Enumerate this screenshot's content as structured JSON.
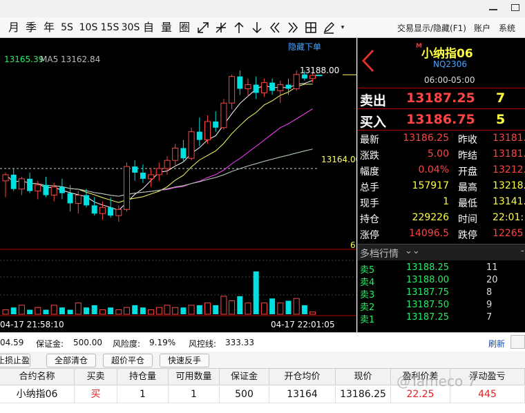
{
  "toolbar": {
    "periods": [
      "月",
      "季",
      "年",
      "5S",
      "10S",
      "15S",
      "30S",
      "自",
      "量",
      "圈"
    ],
    "menu": [
      "交易显示/隐藏(F1)",
      "账户",
      "系统"
    ]
  },
  "chart": {
    "price_label": "13165.39",
    "ma_label": "MA5 13162.84",
    "hide_orders": "隐藏下单",
    "high_label": "13188.00",
    "level_label": "13164.00",
    "right_mark": "6",
    "time_left": "04-17 21:58:10",
    "time_right": "04-17 22:01:05"
  },
  "chart_data": {
    "type": "candlestick",
    "x_start_label": "04-17 21:58:10",
    "x_end_label": "04-17 22:01:05",
    "price_labels": [
      "13188.00",
      "13164.00"
    ],
    "candles": [
      {
        "o": 13161.0,
        "h": 13163.0,
        "l": 13157.0,
        "c": 13162.5
      },
      {
        "o": 13162.5,
        "h": 13164.0,
        "l": 13158.5,
        "c": 13159.0
      },
      {
        "o": 13159.0,
        "h": 13162.0,
        "l": 13157.5,
        "c": 13161.5
      },
      {
        "o": 13161.5,
        "h": 13163.0,
        "l": 13158.0,
        "c": 13158.5
      },
      {
        "o": 13158.5,
        "h": 13161.0,
        "l": 13156.5,
        "c": 13160.0
      },
      {
        "o": 13160.0,
        "h": 13162.0,
        "l": 13157.0,
        "c": 13157.5
      },
      {
        "o": 13157.5,
        "h": 13160.5,
        "l": 13156.0,
        "c": 13159.5
      },
      {
        "o": 13159.5,
        "h": 13161.5,
        "l": 13156.5,
        "c": 13158.0
      },
      {
        "o": 13158.0,
        "h": 13160.0,
        "l": 13153.5,
        "c": 13155.5
      },
      {
        "o": 13155.5,
        "h": 13158.5,
        "l": 13153.0,
        "c": 13157.5
      },
      {
        "o": 13157.5,
        "h": 13159.0,
        "l": 13154.5,
        "c": 13155.0
      },
      {
        "o": 13155.0,
        "h": 13157.0,
        "l": 13152.5,
        "c": 13153.0
      },
      {
        "o": 13153.0,
        "h": 13156.0,
        "l": 13151.5,
        "c": 13154.5
      },
      {
        "o": 13154.5,
        "h": 13157.0,
        "l": 13152.0,
        "c": 13152.5
      },
      {
        "o": 13152.5,
        "h": 13155.0,
        "l": 13151.0,
        "c": 13154.0
      },
      {
        "o": 13154.0,
        "h": 13165.5,
        "l": 13153.5,
        "c": 13164.5
      },
      {
        "o": 13164.5,
        "h": 13166.0,
        "l": 13161.0,
        "c": 13163.0
      },
      {
        "o": 13163.0,
        "h": 13165.0,
        "l": 13160.5,
        "c": 13161.5
      },
      {
        "o": 13161.5,
        "h": 13164.0,
        "l": 13159.5,
        "c": 13162.5
      },
      {
        "o": 13162.5,
        "h": 13165.5,
        "l": 13161.0,
        "c": 13164.0
      },
      {
        "o": 13164.0,
        "h": 13167.0,
        "l": 13162.5,
        "c": 13166.0
      },
      {
        "o": 13166.0,
        "h": 13170.0,
        "l": 13164.5,
        "c": 13169.0
      },
      {
        "o": 13169.0,
        "h": 13171.0,
        "l": 13165.5,
        "c": 13166.5
      },
      {
        "o": 13166.5,
        "h": 13174.0,
        "l": 13166.0,
        "c": 13173.0
      },
      {
        "o": 13173.0,
        "h": 13176.5,
        "l": 13169.5,
        "c": 13171.0
      },
      {
        "o": 13171.0,
        "h": 13177.0,
        "l": 13170.0,
        "c": 13175.5
      },
      {
        "o": 13175.5,
        "h": 13178.0,
        "l": 13173.0,
        "c": 13174.0
      },
      {
        "o": 13174.0,
        "h": 13181.0,
        "l": 13173.5,
        "c": 13180.0
      },
      {
        "o": 13180.0,
        "h": 13187.0,
        "l": 13178.5,
        "c": 13186.5
      },
      {
        "o": 13186.5,
        "h": 13188.0,
        "l": 13182.0,
        "c": 13183.5
      },
      {
        "o": 13183.5,
        "h": 13186.0,
        "l": 13181.5,
        "c": 13184.5
      },
      {
        "o": 13184.5,
        "h": 13186.5,
        "l": 13181.0,
        "c": 13182.5
      },
      {
        "o": 13182.5,
        "h": 13186.0,
        "l": 13181.5,
        "c": 13185.0
      },
      {
        "o": 13185.0,
        "h": 13186.0,
        "l": 13182.0,
        "c": 13183.0
      },
      {
        "o": 13183.0,
        "h": 13185.5,
        "l": 13180.0,
        "c": 13184.5
      },
      {
        "o": 13184.5,
        "h": 13186.0,
        "l": 13182.0,
        "c": 13183.5
      },
      {
        "o": 13183.5,
        "h": 13188.0,
        "l": 13183.0,
        "c": 13187.0
      },
      {
        "o": 13187.0,
        "h": 13188.0,
        "l": 13185.5,
        "c": 13186.0
      },
      {
        "o": 13186.0,
        "h": 13187.5,
        "l": 13185.0,
        "c": 13186.75
      }
    ],
    "volumes": [
      2,
      3,
      4,
      2,
      3,
      2,
      4,
      3,
      2,
      5,
      3,
      4,
      2,
      3,
      2,
      3,
      4,
      3,
      2,
      3,
      4,
      3,
      3,
      4,
      4,
      5,
      4,
      8,
      6,
      8,
      5,
      19,
      5,
      7,
      5,
      6,
      7,
      4,
      1
    ],
    "ma_colors": [
      "#ffffff",
      "#ffff66",
      "#ff44ff",
      "#44dd44",
      "#bbbbbb"
    ]
  },
  "quote": {
    "name": "小纳指06",
    "code": "NQ2306",
    "hours": "06:00-05:00",
    "sell": {
      "label": "卖出",
      "price": "13187.25",
      "vol": "7"
    },
    "buy": {
      "label": "买入",
      "price": "13186.75",
      "vol": "5"
    },
    "stats": [
      [
        "最新",
        "13186.25",
        "昨收",
        "13181.",
        "#ff4444"
      ],
      [
        "涨跌",
        "5.00",
        "昨结",
        "13181.",
        "#ff4444"
      ],
      [
        "幅度",
        "0.04%",
        "开盘",
        "13212.",
        "#ff4444"
      ],
      [
        "总手",
        "157917",
        "最高",
        "13218.",
        "#ffff44"
      ],
      [
        "现手",
        "1",
        "最低",
        "13141.",
        "#ffff44"
      ],
      [
        "持仓",
        "229226",
        "时间",
        "22:01:",
        "#ffff44"
      ],
      [
        "涨停",
        "14096.5",
        "跌停",
        "12265",
        "#ff4444"
      ]
    ],
    "depth_title": "多档行情",
    "depth": [
      [
        "卖5",
        "13188.25",
        "11"
      ],
      [
        "卖4",
        "13188.00",
        "20"
      ],
      [
        "卖3",
        "13187.75",
        "8"
      ],
      [
        "卖2",
        "13187.50",
        "9"
      ],
      [
        "卖1",
        "13187.25",
        "7"
      ]
    ]
  },
  "status": {
    "balance": "04.59",
    "margin_label": "保证金:",
    "margin": "500.00",
    "risk_label": "风险度:",
    "risk": "9.19%",
    "control_label": "风控线:",
    "control": "333.33",
    "refresh": "刷新"
  },
  "actions": [
    "止损止盈",
    "全部清仓",
    "超价平仓",
    "快速反手"
  ],
  "table": {
    "headers": [
      "合约名称",
      "买卖",
      "持仓量",
      "可用数量",
      "保证金",
      "开仓均价",
      "现价",
      "盈利价差",
      "浮动盈亏"
    ],
    "row": [
      "小纳指06",
      "买",
      "1",
      "1",
      "500",
      "13164",
      "13186.25",
      "22.25",
      "445"
    ]
  },
  "watermark": "@Tameco 7",
  "colors": {
    "red": "#ff4444",
    "yellow": "#ffff44",
    "green": "#22ee66",
    "cyan": "#00e0e0"
  }
}
